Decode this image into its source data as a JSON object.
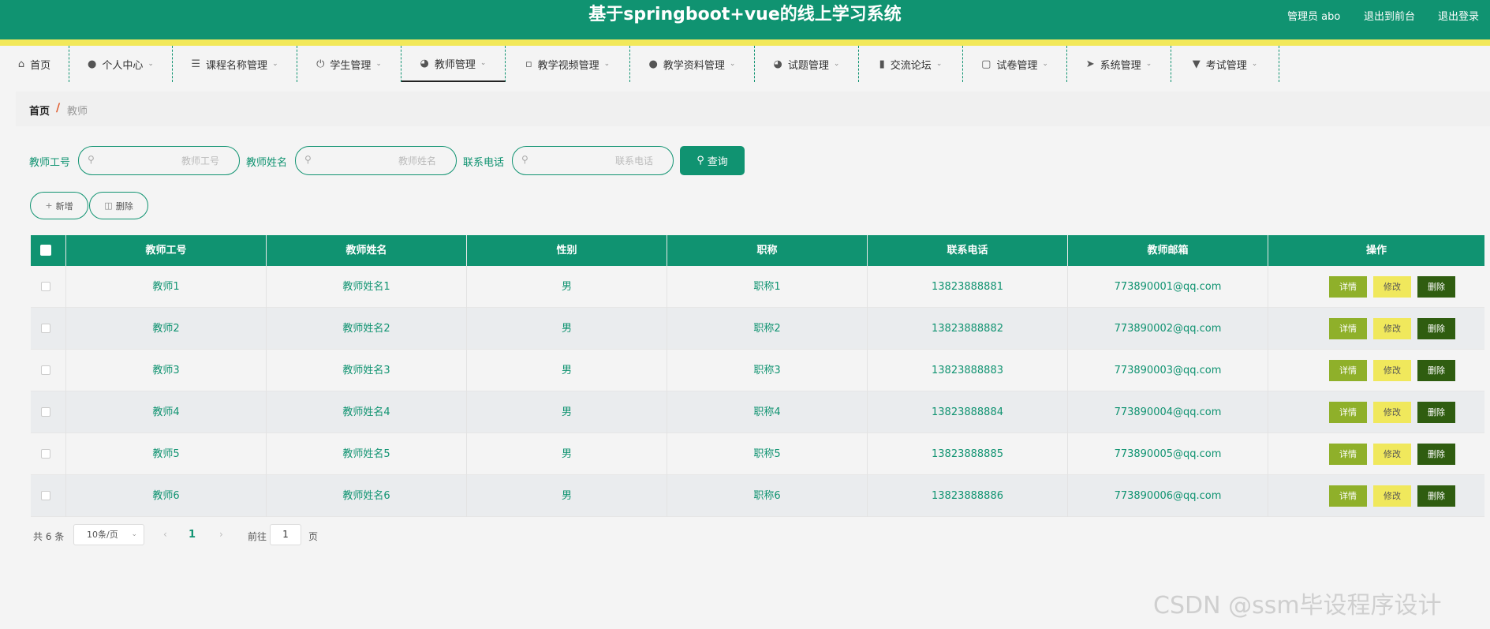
{
  "header": {
    "title": "基于springboot+vue的线上学习系统",
    "admin_label": "管理员 abo",
    "to_front": "退出到前台",
    "logout": "退出登录"
  },
  "nav": {
    "items": [
      {
        "label": "首页",
        "icon": "home-icon",
        "active": false
      },
      {
        "label": "个人中心",
        "icon": "user-icon",
        "active": false
      },
      {
        "label": "课程名称管理",
        "icon": "list-icon",
        "active": false
      },
      {
        "label": "学生管理",
        "icon": "power-icon",
        "active": false
      },
      {
        "label": "教师管理",
        "icon": "compass-icon",
        "active": true
      },
      {
        "label": "教学视频管理",
        "icon": "chat-icon",
        "active": false
      },
      {
        "label": "教学资料管理",
        "icon": "user-icon",
        "active": false
      },
      {
        "label": "试题管理",
        "icon": "compass-icon",
        "active": false
      },
      {
        "label": "交流论坛",
        "icon": "bar-chart-icon",
        "active": false
      },
      {
        "label": "试卷管理",
        "icon": "briefcase-icon",
        "active": false
      },
      {
        "label": "系统管理",
        "icon": "send-icon",
        "active": false
      },
      {
        "label": "考试管理",
        "icon": "pin-icon",
        "active": false
      }
    ]
  },
  "breadcrumb": {
    "home": "首页",
    "separator": "/",
    "current": "教师"
  },
  "search": {
    "teacher_id_label": "教师工号",
    "teacher_id_placeholder": "教师工号",
    "teacher_id_value": "",
    "teacher_name_label": "教师姓名",
    "teacher_name_placeholder": "教师姓名",
    "teacher_name_value": "",
    "phone_label": "联系电话",
    "phone_placeholder": "联系电话",
    "phone_value": "",
    "query_label": "查询"
  },
  "actions": {
    "add_label": "新增",
    "delete_label": "删除"
  },
  "table": {
    "headers": [
      "教师工号",
      "教师姓名",
      "性别",
      "职称",
      "联系电话",
      "教师邮箱",
      "操作"
    ],
    "rows": [
      {
        "id": "教师1",
        "name": "教师姓名1",
        "gender": "男",
        "title": "职称1",
        "phone": "13823888881",
        "email": "773890001@qq.com"
      },
      {
        "id": "教师2",
        "name": "教师姓名2",
        "gender": "男",
        "title": "职称2",
        "phone": "13823888882",
        "email": "773890002@qq.com"
      },
      {
        "id": "教师3",
        "name": "教师姓名3",
        "gender": "男",
        "title": "职称3",
        "phone": "13823888883",
        "email": "773890003@qq.com"
      },
      {
        "id": "教师4",
        "name": "教师姓名4",
        "gender": "男",
        "title": "职称4",
        "phone": "13823888884",
        "email": "773890004@qq.com"
      },
      {
        "id": "教师5",
        "name": "教师姓名5",
        "gender": "男",
        "title": "职称5",
        "phone": "13823888885",
        "email": "773890005@qq.com"
      },
      {
        "id": "教师6",
        "name": "教师姓名6",
        "gender": "男",
        "title": "职称6",
        "phone": "13823888886",
        "email": "773890006@qq.com"
      }
    ],
    "row_actions": {
      "detail": "详情",
      "edit": "修改",
      "delete": "删除"
    }
  },
  "pagination": {
    "total_text": "共 6 条",
    "page_size": "10条/页",
    "current_page": "1",
    "goto_label": "前往",
    "goto_value": "1",
    "page_suffix": "页"
  },
  "watermark": "CSDN @ssm毕设程序设计",
  "colors": {
    "primary": "#109371",
    "stripe": "#f2e85a",
    "detail_btn": "#8fb02a",
    "edit_btn": "#f0e85c",
    "delete_btn": "#2f5d10"
  }
}
